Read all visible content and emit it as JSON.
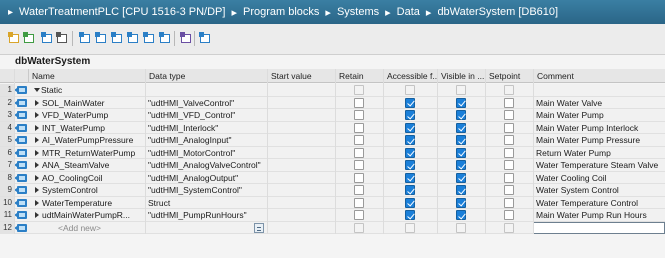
{
  "breadcrumb": {
    "lead": "▸",
    "items": [
      "WaterTreatmentPLC [CPU 1516-3 PN/DP]",
      "Program blocks",
      "Systems",
      "Data",
      "dbWaterSystem [DB610]"
    ],
    "separator": "▸"
  },
  "toolbar": {
    "icons": [
      "insert-row-icon",
      "add-row-icon",
      "monitor-values-icon",
      "edit-icon",
      "snapshot-icon",
      "copy-snapshot-icon",
      "load-snapshot-icon",
      "set-start-value-icon",
      "reset-start-value-icon",
      "expand-all-icon",
      "memory-icon",
      "watch-icon"
    ]
  },
  "block": {
    "title": "dbWaterSystem"
  },
  "columns": [
    "Name",
    "Data type",
    "Start value",
    "Retain",
    "Accessible f...",
    "Visible in ...",
    "Setpoint",
    "Comment"
  ],
  "rows": [
    {
      "num": "1",
      "expander": "open",
      "name": "Static",
      "type": "",
      "retain": null,
      "accessible": null,
      "visible": null,
      "setpoint": null,
      "comment": ""
    },
    {
      "num": "2",
      "expander": "closed",
      "name": "SOL_MainWater",
      "type": "\"udtHMI_ValveControl\"",
      "retain": false,
      "accessible": true,
      "visible": true,
      "setpoint": false,
      "comment": "Main Water Valve"
    },
    {
      "num": "3",
      "expander": "closed",
      "name": "VFD_WaterPump",
      "type": "\"udtHMI_VFD_Control\"",
      "retain": false,
      "accessible": true,
      "visible": true,
      "setpoint": false,
      "comment": "Main Water Pump"
    },
    {
      "num": "4",
      "expander": "closed",
      "name": "INT_WaterPump",
      "type": "\"udtHMI_Interlock\"",
      "retain": false,
      "accessible": true,
      "visible": true,
      "setpoint": false,
      "comment": "Main Water Pump Interlock"
    },
    {
      "num": "5",
      "expander": "closed",
      "name": "AI_WaterPumpPressure",
      "type": "\"udtHMI_AnalogInput\"",
      "retain": false,
      "accessible": true,
      "visible": true,
      "setpoint": false,
      "comment": "Main Water Pump Pressure"
    },
    {
      "num": "6",
      "expander": "closed",
      "name": "MTR_ReturnWaterPump",
      "type": "\"udtHMI_MotorControl\"",
      "retain": false,
      "accessible": true,
      "visible": true,
      "setpoint": false,
      "comment": "Return Water Pump"
    },
    {
      "num": "7",
      "expander": "closed",
      "name": "ANA_SteamValve",
      "type": "\"udtHMI_AnalogValveControl\"",
      "retain": false,
      "accessible": true,
      "visible": true,
      "setpoint": false,
      "comment": "Water Temperature Steam Valve"
    },
    {
      "num": "8",
      "expander": "closed",
      "name": "AO_CoolingCoil",
      "type": "\"udtHMI_AnalogOutput\"",
      "retain": false,
      "accessible": true,
      "visible": true,
      "setpoint": false,
      "comment": "Water Cooling Coil"
    },
    {
      "num": "9",
      "expander": "closed",
      "name": "SystemControl",
      "type": "\"udtHMI_SystemControl\"",
      "retain": false,
      "accessible": true,
      "visible": true,
      "setpoint": false,
      "comment": "Water System Control"
    },
    {
      "num": "10",
      "expander": "closed",
      "name": "WaterTemperature",
      "type": "Struct",
      "retain": false,
      "accessible": true,
      "visible": true,
      "setpoint": false,
      "comment": "Water Temperature Control"
    },
    {
      "num": "11",
      "expander": "closed",
      "name": "udtMainWaterPumpR...",
      "type": "\"udtHMI_PumpRunHours\"",
      "retain": false,
      "accessible": true,
      "visible": true,
      "setpoint": false,
      "comment": "Main Water Pump Run Hours"
    },
    {
      "num": "12",
      "expander": "none",
      "name": "<Add new>",
      "type": "",
      "retain": null,
      "accessible": null,
      "visible": null,
      "setpoint": null,
      "comment": ""
    }
  ],
  "colors": {
    "titlebar": "#2f6f93",
    "checked": "#1a7fd9",
    "rowicon": "#2b7fc6"
  }
}
